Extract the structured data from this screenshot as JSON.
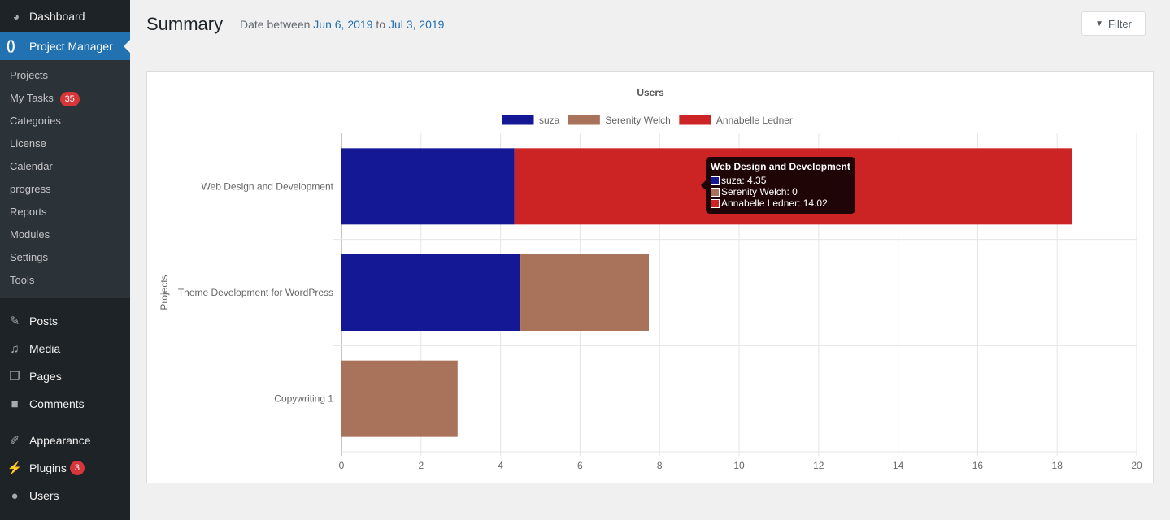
{
  "sidebar": {
    "dashboard": "Dashboard",
    "active": "Project Manager",
    "submenu": [
      {
        "label": "Projects"
      },
      {
        "label": "My Tasks",
        "badge": "35"
      },
      {
        "label": "Categories"
      },
      {
        "label": "License"
      },
      {
        "label": "Calendar"
      },
      {
        "label": "progress"
      },
      {
        "label": "Reports"
      },
      {
        "label": "Modules"
      },
      {
        "label": "Settings"
      },
      {
        "label": "Tools"
      }
    ],
    "menu": [
      {
        "label": "Posts",
        "icon": "pin-icon"
      },
      {
        "label": "Media",
        "icon": "media-icon"
      },
      {
        "label": "Pages",
        "icon": "pages-icon"
      },
      {
        "label": "Comments",
        "icon": "comment-icon"
      },
      {
        "label": "Appearance",
        "icon": "brush-icon"
      },
      {
        "label": "Plugins",
        "icon": "plug-icon",
        "badge": "3"
      },
      {
        "label": "Users",
        "icon": "user-icon"
      }
    ]
  },
  "header": {
    "title": "Summary",
    "date_prefix": "Date between",
    "date_from": "Jun 6, 2019",
    "date_to_word": "to",
    "date_to": "Jul 3, 2019",
    "filter": "Filter"
  },
  "chart_data": {
    "type": "bar",
    "orientation": "horizontal",
    "stacked": true,
    "title": "Users",
    "ylabel": "Projects",
    "xlabel": "",
    "categories": [
      "Web Design and Development",
      "Theme Development for WordPress",
      "Copywriting 1"
    ],
    "series": [
      {
        "name": "suza",
        "color": "#141894",
        "values": [
          4.35,
          4.5,
          0
        ]
      },
      {
        "name": "Serenity Welch",
        "color": "#a8735a",
        "values": [
          0,
          3.23,
          2.92
        ]
      },
      {
        "name": "Annabelle Ledner",
        "color": "#cc2424",
        "values": [
          14.02,
          0,
          0
        ]
      }
    ],
    "xlim": [
      0,
      20
    ],
    "xticks": [
      "0",
      "2",
      "4",
      "6",
      "8",
      "10",
      "12",
      "14",
      "16",
      "18",
      "20"
    ],
    "grid": true,
    "legend": "top",
    "tooltip": {
      "title": "Web Design and Development",
      "rows": [
        "suza: 4.35",
        "Serenity Welch: 0",
        "Annabelle Ledner: 14.02"
      ]
    }
  }
}
